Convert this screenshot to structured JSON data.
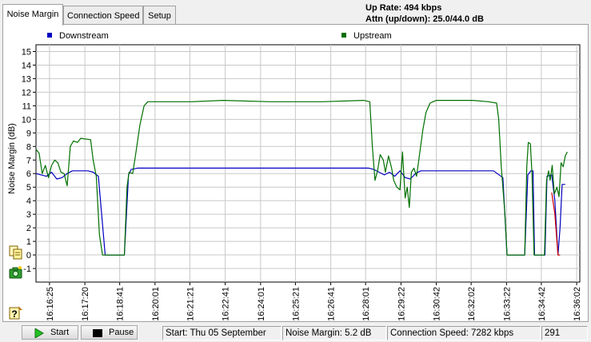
{
  "tabs": [
    {
      "label": "Noise Margin",
      "active": true
    },
    {
      "label": "Connection Speed",
      "active": false
    },
    {
      "label": "Setup",
      "active": false
    }
  ],
  "info": {
    "up_rate": "Up Rate: 494 kbps",
    "attn": "Attn (up/down): 25.0/44.0 dB"
  },
  "chart_data": {
    "type": "line",
    "title": "",
    "ylabel": "Noise Margin (dB)",
    "xlabel": "",
    "ylim": [
      -2,
      15.5
    ],
    "yticks": [
      -1,
      0,
      1,
      2,
      3,
      4,
      5,
      6,
      7,
      8,
      9,
      10,
      11,
      12,
      13,
      14,
      15
    ],
    "x_tick_labels": [
      "16:16:25",
      "16:17:20",
      "16:18:41",
      "16:20:01",
      "16:21:21",
      "16:22:41",
      "16:24:01",
      "16:25:21",
      "16:26:41",
      "16:28:01",
      "16:29:22",
      "16:30:42",
      "16:32:02",
      "16:33:22",
      "16:34:42",
      "16:36:02"
    ],
    "xlim": [
      0,
      100
    ],
    "x_tick_positions": [
      2.6,
      9.4,
      16.1,
      22.9,
      29.6,
      36.4,
      43.2,
      49.9,
      56.7,
      63.4,
      70.2,
      77.0,
      83.7,
      90.5,
      97.2,
      104.0
    ],
    "grid": true,
    "legend": [
      {
        "name": "Downstream",
        "color": "#0000c0"
      },
      {
        "name": "Upstream",
        "color": "#007000"
      }
    ],
    "series": [
      {
        "name": "Downstream",
        "color": "#0000c0",
        "points": [
          [
            0,
            6.0
          ],
          [
            1,
            5.9
          ],
          [
            2,
            5.8
          ],
          [
            3,
            6.1
          ],
          [
            4,
            5.6
          ],
          [
            5,
            5.7
          ],
          [
            6,
            6.0
          ],
          [
            7,
            6.2
          ],
          [
            8,
            6.2
          ],
          [
            10,
            6.2
          ],
          [
            11,
            6.1
          ],
          [
            12,
            5.8
          ],
          [
            13.3,
            0
          ],
          [
            17,
            0
          ],
          [
            17.8,
            5.9
          ],
          [
            18.3,
            6.3
          ],
          [
            19.5,
            6.4
          ],
          [
            25,
            6.4
          ],
          [
            40,
            6.4
          ],
          [
            55,
            6.4
          ],
          [
            64,
            6.4
          ],
          [
            65,
            6.3
          ],
          [
            67,
            5.9
          ],
          [
            68,
            6.1
          ],
          [
            69,
            5.8
          ],
          [
            70,
            6.2
          ],
          [
            71,
            5.7
          ],
          [
            72,
            5.6
          ],
          [
            73,
            6.0
          ],
          [
            74,
            6.2
          ],
          [
            76,
            6.2
          ],
          [
            82,
            6.2
          ],
          [
            88,
            6.2
          ],
          [
            89.8,
            5.7
          ],
          [
            90.6,
            0
          ],
          [
            94,
            0
          ],
          [
            94.6,
            5.9
          ],
          [
            95.2,
            6.2
          ],
          [
            95.6,
            6.2
          ],
          [
            95.9,
            0
          ],
          [
            97.9,
            0
          ],
          [
            98.3,
            5.8
          ],
          [
            99.2,
            5.9
          ],
          [
            99.8,
            4.0
          ],
          [
            100.4,
            0
          ],
          [
            100.8,
            2.0
          ],
          [
            101.2,
            5.2
          ],
          [
            101.8,
            5.2
          ]
        ]
      },
      {
        "name": "Upstream",
        "color": "#007000",
        "points": [
          [
            0,
            7.8
          ],
          [
            0.6,
            7.5
          ],
          [
            1.2,
            6.0
          ],
          [
            1.8,
            6.6
          ],
          [
            2.4,
            5.7
          ],
          [
            3,
            6.6
          ],
          [
            3.6,
            7.0
          ],
          [
            4.2,
            6.8
          ],
          [
            4.8,
            6.1
          ],
          [
            5.4,
            6.0
          ],
          [
            6,
            5.1
          ],
          [
            6.6,
            8.0
          ],
          [
            7.2,
            8.4
          ],
          [
            8,
            8.3
          ],
          [
            8.6,
            8.6
          ],
          [
            10.5,
            8.5
          ],
          [
            11,
            7.0
          ],
          [
            11.6,
            5.8
          ],
          [
            12.2,
            1.5
          ],
          [
            12.8,
            0
          ],
          [
            17,
            0
          ],
          [
            17.5,
            5.0
          ],
          [
            17.9,
            6.1
          ],
          [
            18.6,
            6.0
          ],
          [
            19.2,
            7.5
          ],
          [
            20,
            9.6
          ],
          [
            20.8,
            11.0
          ],
          [
            21.5,
            11.3
          ],
          [
            24,
            11.3
          ],
          [
            30,
            11.3
          ],
          [
            36,
            11.4
          ],
          [
            45,
            11.3
          ],
          [
            55,
            11.3
          ],
          [
            63,
            11.4
          ],
          [
            64.2,
            11.3
          ],
          [
            64.7,
            8.0
          ],
          [
            65.2,
            5.5
          ],
          [
            65.7,
            6.2
          ],
          [
            66.2,
            7.4
          ],
          [
            66.8,
            7.0
          ],
          [
            67.2,
            6.1
          ],
          [
            67.8,
            7.3
          ],
          [
            68.4,
            6.4
          ],
          [
            68.8,
            5.5
          ],
          [
            69.4,
            5.0
          ],
          [
            70,
            4.8
          ],
          [
            70.5,
            7.6
          ],
          [
            71,
            4.2
          ],
          [
            71.4,
            5.0
          ],
          [
            71.8,
            3.5
          ],
          [
            72.2,
            6.1
          ],
          [
            72.7,
            6.4
          ],
          [
            73.2,
            5.8
          ],
          [
            73.8,
            7.5
          ],
          [
            74.4,
            9.2
          ],
          [
            75,
            10.5
          ],
          [
            75.8,
            11.2
          ],
          [
            77,
            11.4
          ],
          [
            80,
            11.4
          ],
          [
            84,
            11.4
          ],
          [
            87,
            11.3
          ],
          [
            88.6,
            11.2
          ],
          [
            89,
            10.0
          ],
          [
            89.5,
            6.5
          ],
          [
            90.2,
            3.0
          ],
          [
            90.6,
            0
          ],
          [
            94,
            0
          ],
          [
            94.4,
            6.5
          ],
          [
            94.7,
            8.3
          ],
          [
            95.1,
            8.2
          ],
          [
            95.4,
            6.0
          ],
          [
            95.8,
            0
          ],
          [
            97.8,
            0
          ],
          [
            98.2,
            5.5
          ],
          [
            98.6,
            6.2
          ],
          [
            98.9,
            5.5
          ],
          [
            99.3,
            6.6
          ],
          [
            99.7,
            4.5
          ],
          [
            100.2,
            5.0
          ],
          [
            100.6,
            4.3
          ],
          [
            101,
            6.8
          ],
          [
            101.4,
            6.5
          ],
          [
            101.8,
            7.3
          ],
          [
            102.2,
            7.6
          ]
        ]
      },
      {
        "name": "",
        "color": "#d00000",
        "points": [
          [
            99.2,
            4.6
          ],
          [
            99.8,
            3.0
          ],
          [
            100.4,
            0
          ],
          [
            100.8,
            0
          ]
        ]
      }
    ]
  },
  "buttons": {
    "start": "Start",
    "pause": "Pause"
  },
  "status": {
    "start": "Start: Thu 05 September",
    "noise": "Noise Margin: 5.2 dB",
    "speed": "Connection Speed: 7282 kbps",
    "count": "291"
  },
  "icons": {
    "copy": "copy-icon",
    "camera": "camera-icon",
    "help": "help-icon",
    "play": "play-icon",
    "stop": "stop-icon"
  }
}
